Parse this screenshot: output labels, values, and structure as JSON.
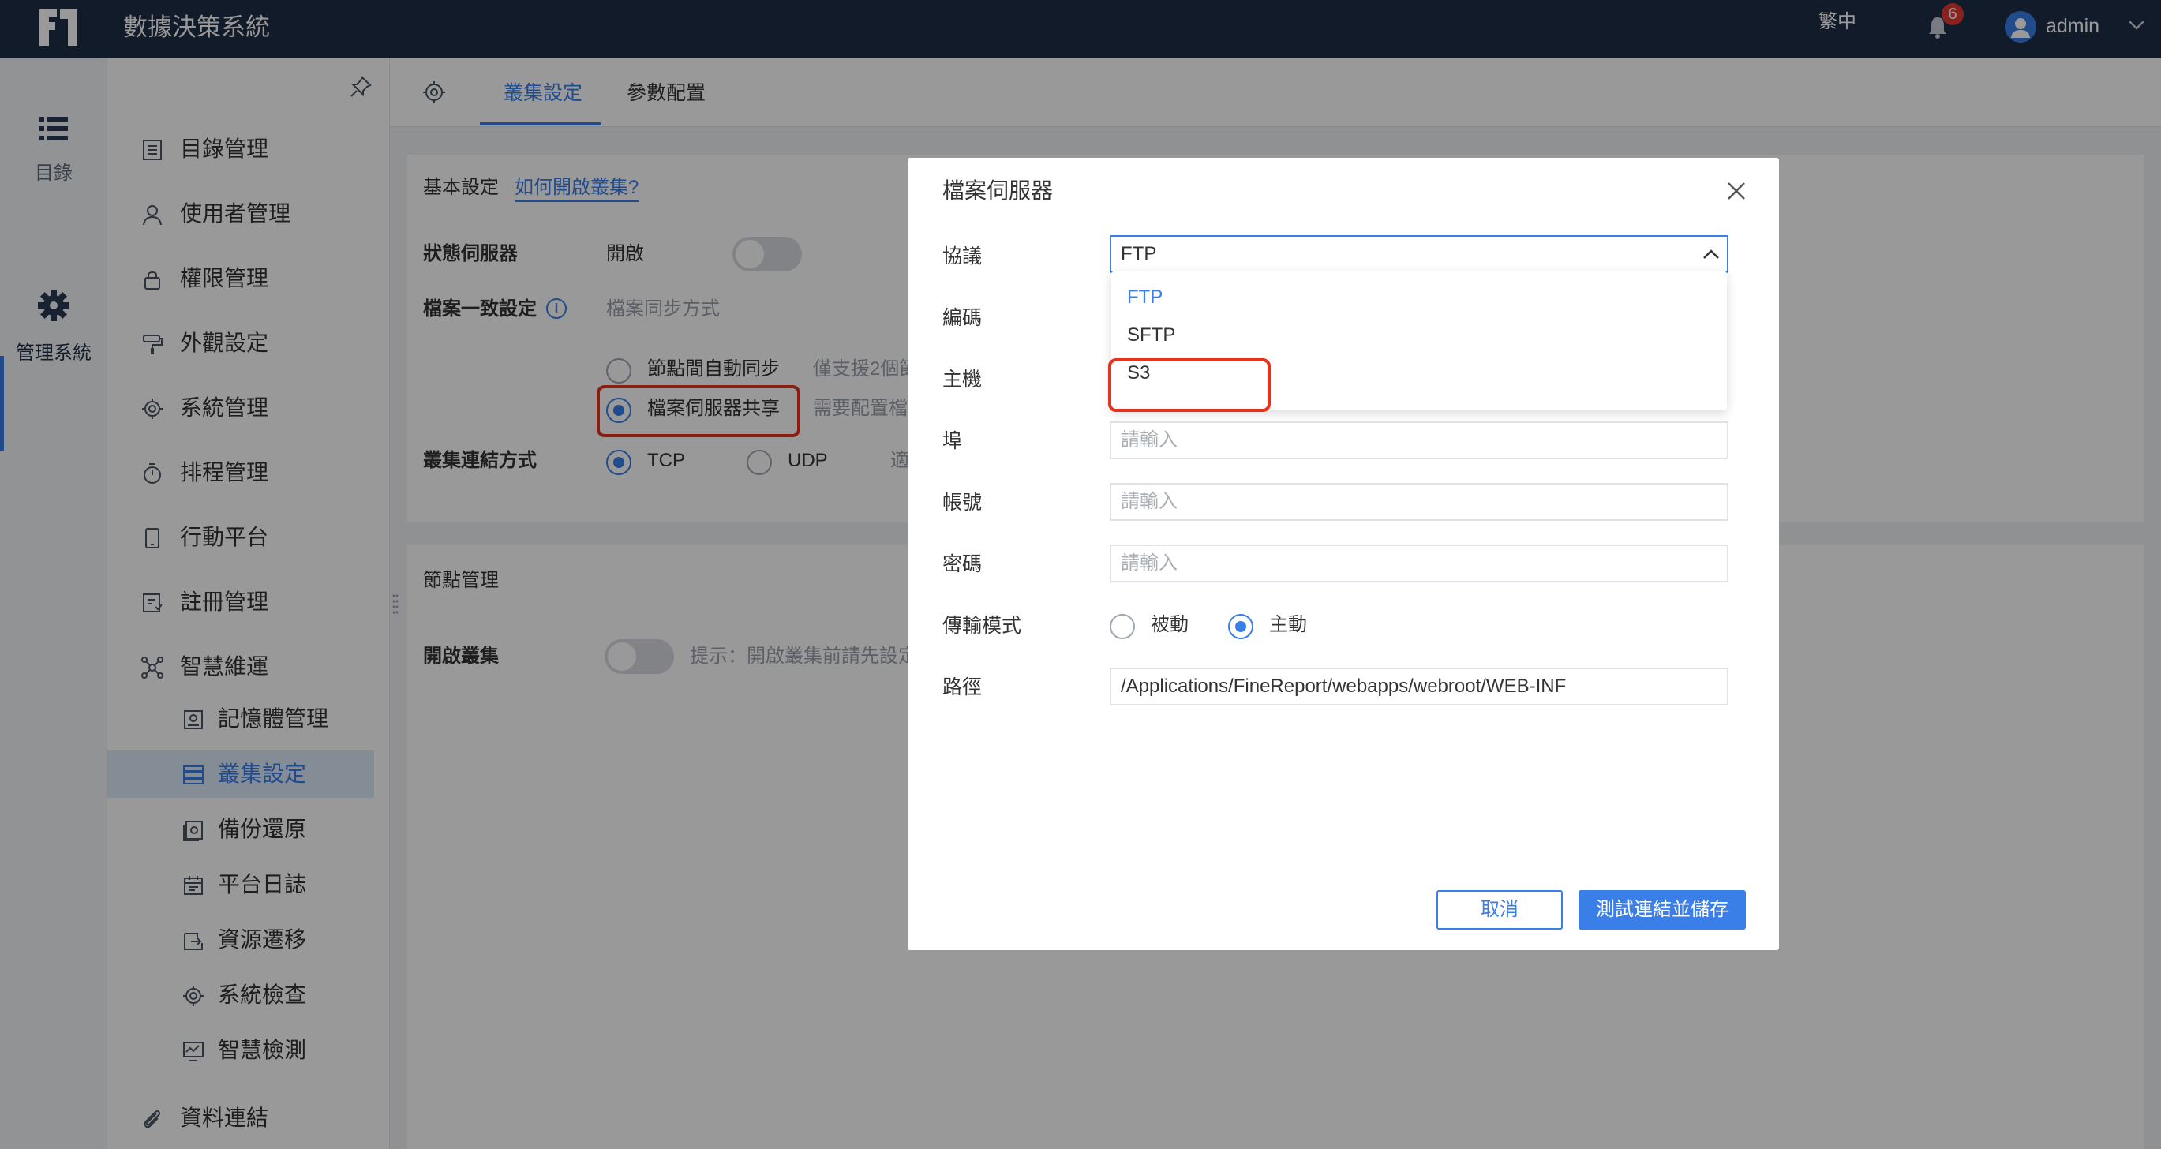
{
  "header": {
    "app_title": "數據決策系統",
    "language": "繁中",
    "notification_count": "6",
    "user": "admin"
  },
  "rail": {
    "items": [
      {
        "label": "目錄",
        "icon": "list-icon"
      },
      {
        "label": "管理系統",
        "icon": "gear-icon"
      }
    ]
  },
  "sidebar": {
    "items": [
      {
        "label": "目錄管理",
        "icon": "document-list-icon"
      },
      {
        "label": "使用者管理",
        "icon": "user-icon"
      },
      {
        "label": "權限管理",
        "icon": "lock-icon"
      },
      {
        "label": "外觀設定",
        "icon": "paint-roller-icon"
      },
      {
        "label": "系統管理",
        "icon": "gear-icon"
      },
      {
        "label": "排程管理",
        "icon": "timer-icon"
      },
      {
        "label": "行動平台",
        "icon": "tablet-icon"
      },
      {
        "label": "註冊管理",
        "icon": "register-icon"
      },
      {
        "label": "智慧維運",
        "icon": "network-icon"
      }
    ],
    "sub_items": [
      {
        "label": "記憶體管理",
        "icon": "memory-icon"
      },
      {
        "label": "叢集設定",
        "icon": "cluster-icon"
      },
      {
        "label": "備份還原",
        "icon": "backup-icon"
      },
      {
        "label": "平台日誌",
        "icon": "calendar-log-icon"
      },
      {
        "label": "資源遷移",
        "icon": "migrate-icon"
      },
      {
        "label": "系統檢查",
        "icon": "check-gear-icon"
      },
      {
        "label": "智慧檢測",
        "icon": "monitor-icon"
      }
    ],
    "bottom_item": {
      "label": "資料連結",
      "icon": "paperclip-icon"
    }
  },
  "tabs": {
    "items": [
      "叢集設定",
      "參數配置"
    ],
    "active": "叢集設定"
  },
  "settings": {
    "section_basic": "基本設定",
    "help_link": "如何開啟叢集?",
    "status_server_label": "狀態伺服器",
    "status_server_value": "開啟",
    "file_consistency_label": "檔案一致設定",
    "sync_method_placeholder": "檔案同步方式",
    "option_auto_sync": "節點間自動同步",
    "option_auto_sync_hint": "僅支援2個節",
    "option_file_server": "檔案伺服器共享",
    "option_file_server_hint": "需要配置檔",
    "cluster_connection_label": "叢集連結方式",
    "tcp": "TCP",
    "udp": "UDP",
    "udp_hint": "適",
    "section_nodes": "節點管理",
    "enable_cluster_label": "開啟叢集",
    "enable_cluster_hint": "提示：開啟叢集前請先設定"
  },
  "modal": {
    "title": "檔案伺服器",
    "protocol_label": "協議",
    "protocol_value": "FTP",
    "protocol_options": [
      "FTP",
      "SFTP",
      "S3"
    ],
    "encoding_label": "編碼",
    "host_label": "主機",
    "port_label": "埠",
    "port_placeholder": "請輸入",
    "account_label": "帳號",
    "account_placeholder": "請輸入",
    "password_label": "密碼",
    "password_placeholder": "請輸入",
    "transfer_mode_label": "傳輸模式",
    "passive": "被動",
    "active": "主動",
    "path_label": "路徑",
    "path_value": "/Applications/FineReport/webapps/webroot/WEB-INF",
    "cancel": "取消",
    "test_save": "測試連結並儲存"
  },
  "colors": {
    "accent": "#3a7ee8",
    "topbar": "#1f2d46",
    "highlight_box": "#e8321c"
  }
}
